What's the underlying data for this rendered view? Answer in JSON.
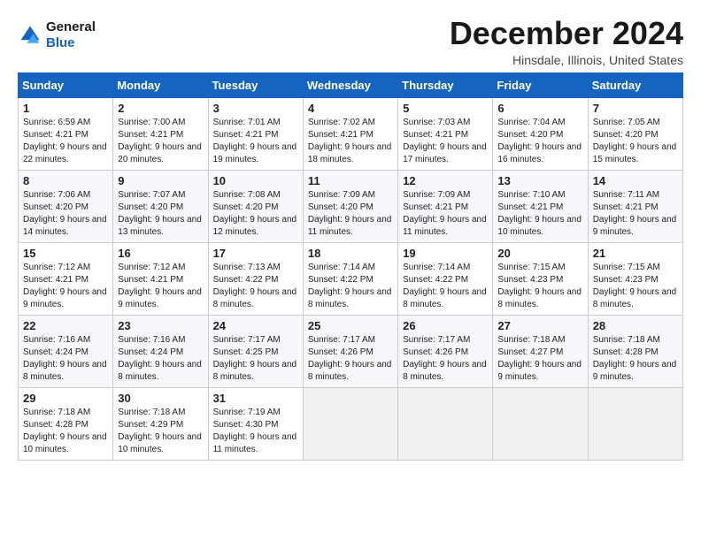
{
  "logo": {
    "line1": "General",
    "line2": "Blue"
  },
  "title": "December 2024",
  "location": "Hinsdale, Illinois, United States",
  "days_header": [
    "Sunday",
    "Monday",
    "Tuesday",
    "Wednesday",
    "Thursday",
    "Friday",
    "Saturday"
  ],
  "weeks": [
    [
      {
        "day": 1,
        "sunrise": "6:59 AM",
        "sunset": "4:21 PM",
        "daylight": "9 hours and 22 minutes."
      },
      {
        "day": 2,
        "sunrise": "7:00 AM",
        "sunset": "4:21 PM",
        "daylight": "9 hours and 20 minutes."
      },
      {
        "day": 3,
        "sunrise": "7:01 AM",
        "sunset": "4:21 PM",
        "daylight": "9 hours and 19 minutes."
      },
      {
        "day": 4,
        "sunrise": "7:02 AM",
        "sunset": "4:21 PM",
        "daylight": "9 hours and 18 minutes."
      },
      {
        "day": 5,
        "sunrise": "7:03 AM",
        "sunset": "4:21 PM",
        "daylight": "9 hours and 17 minutes."
      },
      {
        "day": 6,
        "sunrise": "7:04 AM",
        "sunset": "4:20 PM",
        "daylight": "9 hours and 16 minutes."
      },
      {
        "day": 7,
        "sunrise": "7:05 AM",
        "sunset": "4:20 PM",
        "daylight": "9 hours and 15 minutes."
      }
    ],
    [
      {
        "day": 8,
        "sunrise": "7:06 AM",
        "sunset": "4:20 PM",
        "daylight": "9 hours and 14 minutes."
      },
      {
        "day": 9,
        "sunrise": "7:07 AM",
        "sunset": "4:20 PM",
        "daylight": "9 hours and 13 minutes."
      },
      {
        "day": 10,
        "sunrise": "7:08 AM",
        "sunset": "4:20 PM",
        "daylight": "9 hours and 12 minutes."
      },
      {
        "day": 11,
        "sunrise": "7:09 AM",
        "sunset": "4:20 PM",
        "daylight": "9 hours and 11 minutes."
      },
      {
        "day": 12,
        "sunrise": "7:09 AM",
        "sunset": "4:21 PM",
        "daylight": "9 hours and 11 minutes."
      },
      {
        "day": 13,
        "sunrise": "7:10 AM",
        "sunset": "4:21 PM",
        "daylight": "9 hours and 10 minutes."
      },
      {
        "day": 14,
        "sunrise": "7:11 AM",
        "sunset": "4:21 PM",
        "daylight": "9 hours and 9 minutes."
      }
    ],
    [
      {
        "day": 15,
        "sunrise": "7:12 AM",
        "sunset": "4:21 PM",
        "daylight": "9 hours and 9 minutes."
      },
      {
        "day": 16,
        "sunrise": "7:12 AM",
        "sunset": "4:21 PM",
        "daylight": "9 hours and 9 minutes."
      },
      {
        "day": 17,
        "sunrise": "7:13 AM",
        "sunset": "4:22 PM",
        "daylight": "9 hours and 8 minutes."
      },
      {
        "day": 18,
        "sunrise": "7:14 AM",
        "sunset": "4:22 PM",
        "daylight": "9 hours and 8 minutes."
      },
      {
        "day": 19,
        "sunrise": "7:14 AM",
        "sunset": "4:22 PM",
        "daylight": "9 hours and 8 minutes."
      },
      {
        "day": 20,
        "sunrise": "7:15 AM",
        "sunset": "4:23 PM",
        "daylight": "9 hours and 8 minutes."
      },
      {
        "day": 21,
        "sunrise": "7:15 AM",
        "sunset": "4:23 PM",
        "daylight": "9 hours and 8 minutes."
      }
    ],
    [
      {
        "day": 22,
        "sunrise": "7:16 AM",
        "sunset": "4:24 PM",
        "daylight": "9 hours and 8 minutes."
      },
      {
        "day": 23,
        "sunrise": "7:16 AM",
        "sunset": "4:24 PM",
        "daylight": "9 hours and 8 minutes."
      },
      {
        "day": 24,
        "sunrise": "7:17 AM",
        "sunset": "4:25 PM",
        "daylight": "9 hours and 8 minutes."
      },
      {
        "day": 25,
        "sunrise": "7:17 AM",
        "sunset": "4:26 PM",
        "daylight": "9 hours and 8 minutes."
      },
      {
        "day": 26,
        "sunrise": "7:17 AM",
        "sunset": "4:26 PM",
        "daylight": "9 hours and 8 minutes."
      },
      {
        "day": 27,
        "sunrise": "7:18 AM",
        "sunset": "4:27 PM",
        "daylight": "9 hours and 9 minutes."
      },
      {
        "day": 28,
        "sunrise": "7:18 AM",
        "sunset": "4:28 PM",
        "daylight": "9 hours and 9 minutes."
      }
    ],
    [
      {
        "day": 29,
        "sunrise": "7:18 AM",
        "sunset": "4:28 PM",
        "daylight": "9 hours and 10 minutes."
      },
      {
        "day": 30,
        "sunrise": "7:18 AM",
        "sunset": "4:29 PM",
        "daylight": "9 hours and 10 minutes."
      },
      {
        "day": 31,
        "sunrise": "7:19 AM",
        "sunset": "4:30 PM",
        "daylight": "9 hours and 11 minutes."
      },
      null,
      null,
      null,
      null
    ]
  ]
}
